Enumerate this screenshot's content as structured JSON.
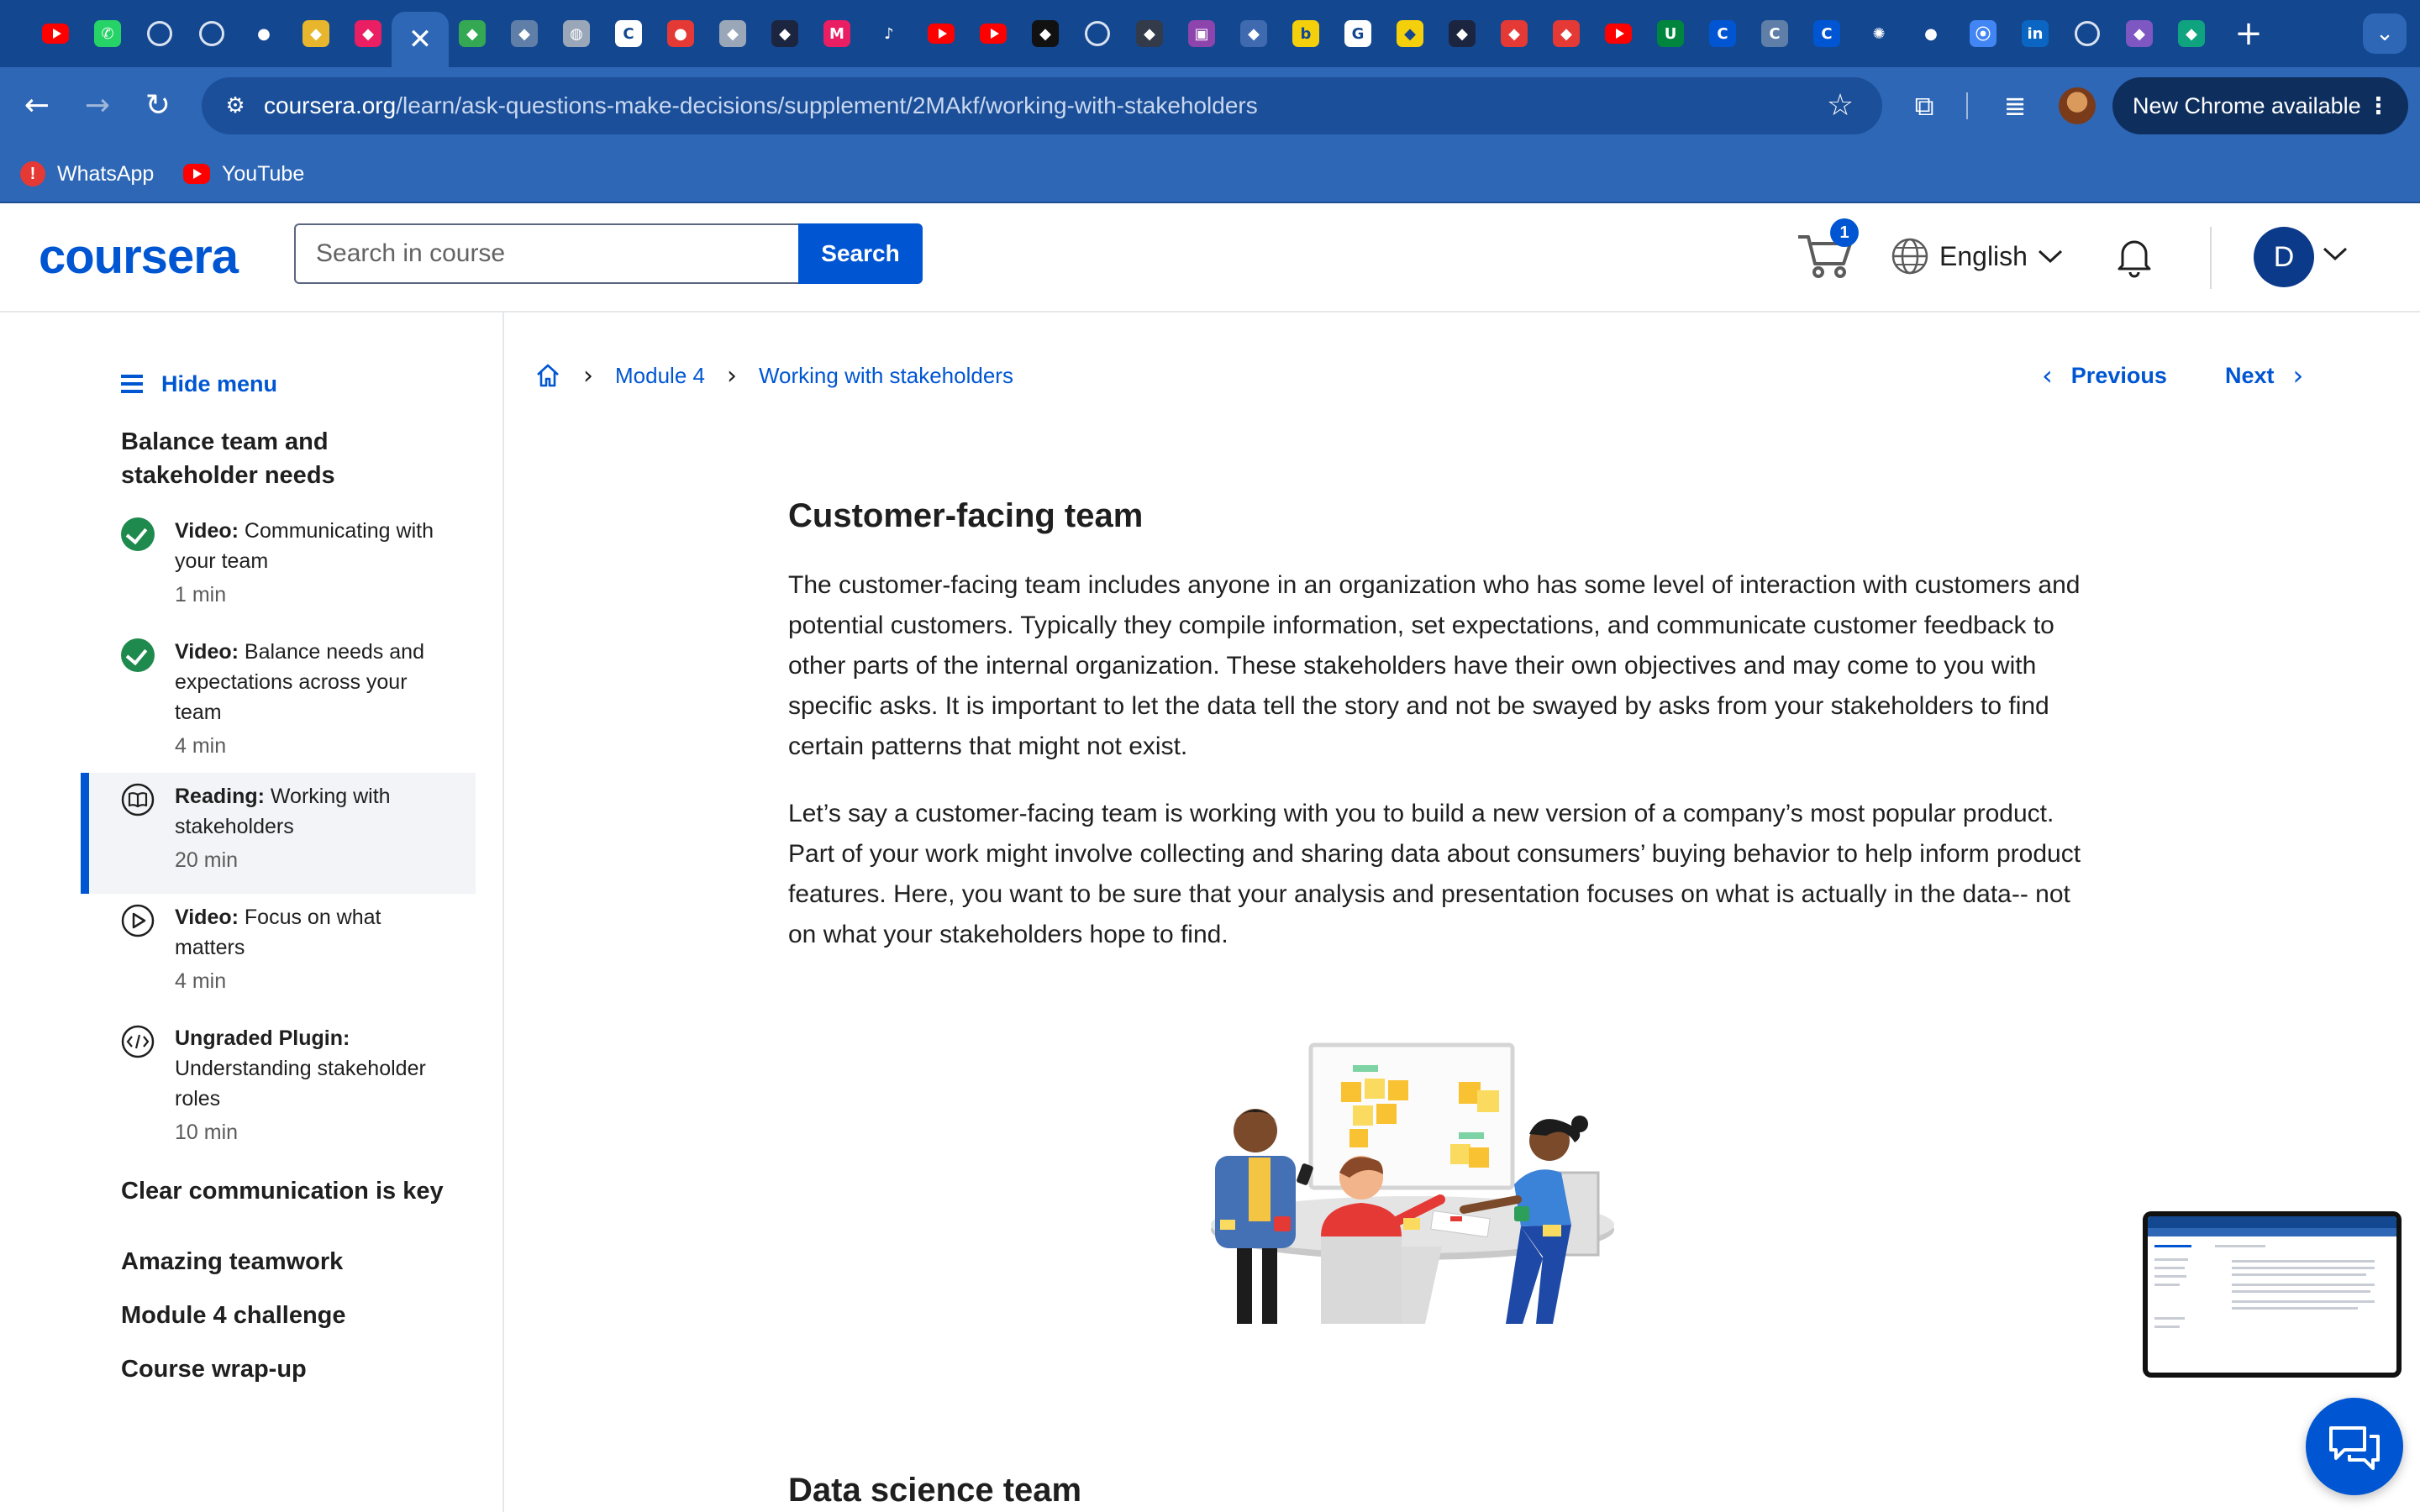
{
  "browser": {
    "tabs": [
      {
        "icon": "youtube-icon",
        "color": "#ff0000"
      },
      {
        "icon": "whatsapp-icon",
        "color": "#25d366"
      },
      {
        "icon": "loading-icon",
        "color": "#d9e2f0"
      },
      {
        "icon": "loading-icon",
        "color": "#d9e2f0"
      },
      {
        "icon": "github-icon",
        "color": "#ffffff"
      },
      {
        "icon": "app-icon",
        "color": "#e8b62c"
      },
      {
        "icon": "app-icon",
        "color": "#e91e63"
      },
      {
        "icon": "close-icon",
        "active": true
      },
      {
        "icon": "app-icon",
        "color": "#34a853"
      },
      {
        "icon": "app-icon",
        "color": "#5f7ea8"
      },
      {
        "icon": "globe-icon",
        "color": "#9aa7b8"
      },
      {
        "icon": "coursera-icon",
        "color": "#ffffff"
      },
      {
        "icon": "record-icon",
        "color": "#e53935"
      },
      {
        "icon": "app-icon",
        "color": "#9aa7b8"
      },
      {
        "icon": "app-icon",
        "color": "#1c2540"
      },
      {
        "icon": "m-icon",
        "color": "#e91e63"
      },
      {
        "icon": "speaker-icon",
        "color": "#ffffff"
      },
      {
        "icon": "youtube-icon",
        "color": "#ff0000"
      },
      {
        "icon": "youtube-icon",
        "color": "#ff0000"
      },
      {
        "icon": "app-icon",
        "color": "#111111"
      },
      {
        "icon": "loading-icon",
        "color": "#d9e2f0"
      },
      {
        "icon": "app-icon",
        "color": "#333a4a"
      },
      {
        "icon": "camera-icon",
        "color": "#8e44ad"
      },
      {
        "icon": "app-icon",
        "color": "#3f6ab0"
      },
      {
        "icon": "b-icon",
        "color": "#f4d00c"
      },
      {
        "icon": "google-icon",
        "color": "#ffffff"
      },
      {
        "icon": "app-icon",
        "color": "#f4d00c"
      },
      {
        "icon": "app-icon",
        "color": "#1c2540"
      },
      {
        "icon": "app-icon",
        "color": "#e53935"
      },
      {
        "icon": "app-icon",
        "color": "#e53935"
      },
      {
        "icon": "youtube-icon",
        "color": "#ff0000"
      },
      {
        "icon": "my-unt-icon",
        "color": "#00853e"
      },
      {
        "icon": "coursera-icon",
        "color": "#0056d2"
      },
      {
        "icon": "coursera-icon",
        "color": "#5f7ea8"
      },
      {
        "icon": "coursera-icon",
        "color": "#0056d2"
      },
      {
        "icon": "chatgpt-icon",
        "color": "#ffffff"
      },
      {
        "icon": "github-icon",
        "color": "#9aa7b8"
      },
      {
        "icon": "maps-pin-icon",
        "color": "#4285f4"
      },
      {
        "icon": "linkedin-icon",
        "color": "#0a66c2"
      },
      {
        "icon": "loading-icon",
        "color": "#d9e2f0"
      },
      {
        "icon": "app-icon",
        "color": "#7e57c2"
      },
      {
        "icon": "app-icon",
        "color": "#10a37f"
      }
    ],
    "url_host": "coursera.org",
    "url_path": "/learn/ask-questions-make-decisions/supplement/2MAkf/working-with-stakeholders",
    "update_label": "New Chrome available",
    "bookmarks": [
      "WhatsApp",
      "YouTube"
    ]
  },
  "header": {
    "logo": "coursera",
    "search_placeholder": "Search in course",
    "search_button": "Search",
    "cart_count": "1",
    "language": "English",
    "avatar_initial": "D"
  },
  "sidebar": {
    "hide_menu": "Hide menu",
    "current_section": "Balance team and stakeholder needs",
    "items": [
      {
        "type": "Video:",
        "title": "Communicating with your team",
        "duration": "1 min",
        "status": "done"
      },
      {
        "type": "Video:",
        "title": "Balance needs and expectations across your team",
        "duration": "4 min",
        "status": "done"
      },
      {
        "type": "Reading:",
        "title": "Working with stakeholders",
        "duration": "20 min",
        "status": "current"
      },
      {
        "type": "Video:",
        "title": "Focus on what matters",
        "duration": "4 min",
        "status": "todo"
      },
      {
        "type": "Ungraded Plugin:",
        "title": "Understanding stakeholder roles",
        "duration": "10 min",
        "status": "todo"
      }
    ],
    "other_sections": [
      "Clear communication is key",
      "Amazing teamwork",
      "Module 4 challenge",
      "Course wrap-up"
    ]
  },
  "breadcrumb": {
    "module": "Module 4",
    "page": "Working with stakeholders"
  },
  "pager": {
    "previous": "Previous",
    "next": "Next"
  },
  "article": {
    "heading": "Customer-facing team",
    "paragraphs": [
      "The customer-facing team includes anyone in an organization who has some level of interaction with customers and potential customers. Typically they compile information, set expectations, and communicate customer feedback to other parts of the internal organization. These stakeholders have their own objectives and may come to you with specific asks. It is important to let the data tell the story and not be swayed by asks from your stakeholders to find certain patterns that might not exist.",
      "Let’s say a customer-facing team is working with you to build a new version of a company’s most popular product. Part of your work might involve collecting and sharing data about consumers’ buying behavior to help inform product features. Here, you want to be sure that your analysis and presentation focuses on what is actually in the data-- not on what your stakeholders hope to find."
    ],
    "next_heading": "Data science team"
  },
  "colors": {
    "brand": "#0056d2",
    "chrome_dark": "#13478f",
    "chrome": "#2d67b6",
    "complete": "#1e8a4d"
  }
}
